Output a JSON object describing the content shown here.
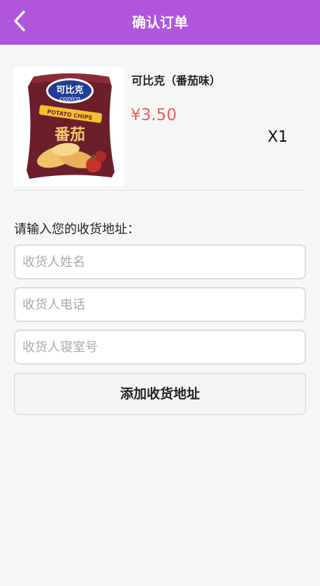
{
  "header": {
    "title": "确认订单",
    "back_icon": "chevron-left-icon",
    "bg_color": "#b055de"
  },
  "product": {
    "name": "可比克（番茄味）",
    "price": "¥3.50",
    "price_color": "#ee5f58",
    "quantity": "X1",
    "image_brand_text": "可比克",
    "image_brand_en": "copico",
    "image_subtitle": "POTATO CHIPS",
    "image_flavor": "番茄"
  },
  "address": {
    "label": "请输入您的收货地址：",
    "name_placeholder": "收货人姓名",
    "phone_placeholder": "收货人电话",
    "dorm_placeholder": "收货人寝室号",
    "submit_label": "添加收货地址"
  }
}
